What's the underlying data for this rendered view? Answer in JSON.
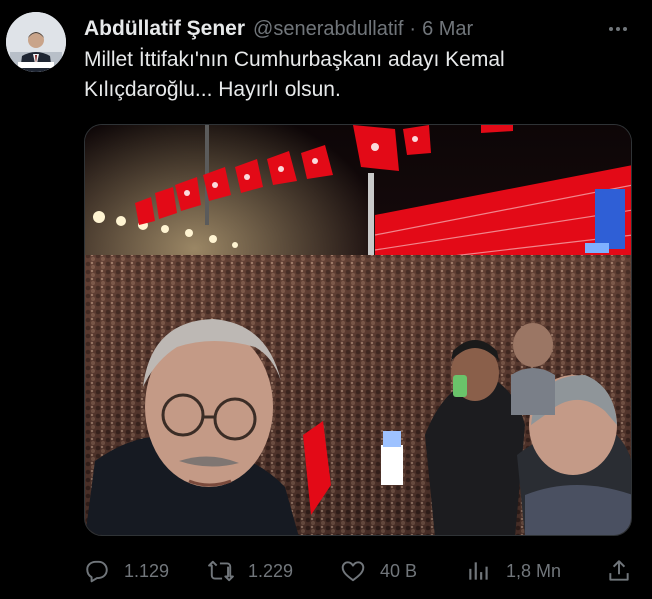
{
  "tweet": {
    "author": {
      "display_name": "Abdüllatif Şener",
      "handle": "@senerabdullatif",
      "avatar_icon": "profile-photo"
    },
    "separator": "·",
    "date": "6 Mar",
    "more_icon": "ellipsis-icon",
    "text_lines": [
      "Millet İttifakı'nın Cumhurbaşkanı adayı Kemal",
      "Kılıçdaroğlu... Hayırlı olsun."
    ],
    "media": {
      "type": "photo",
      "subject": "selfie at night rally with crowd and Turkish flags"
    },
    "actions": {
      "reply": {
        "icon": "reply-icon",
        "count": "1.129"
      },
      "retweet": {
        "icon": "retweet-icon",
        "count": "1.229"
      },
      "like": {
        "icon": "heart-icon",
        "count": "40 B"
      },
      "views": {
        "icon": "views-bar-chart-icon",
        "count": "1,8 Mn"
      },
      "share": {
        "icon": "share-icon"
      }
    }
  },
  "colors": {
    "background": "#000000",
    "text_primary": "#e7e9ea",
    "text_secondary": "#71767b",
    "border": "#2f3336",
    "flag_red": "#e30a17"
  }
}
